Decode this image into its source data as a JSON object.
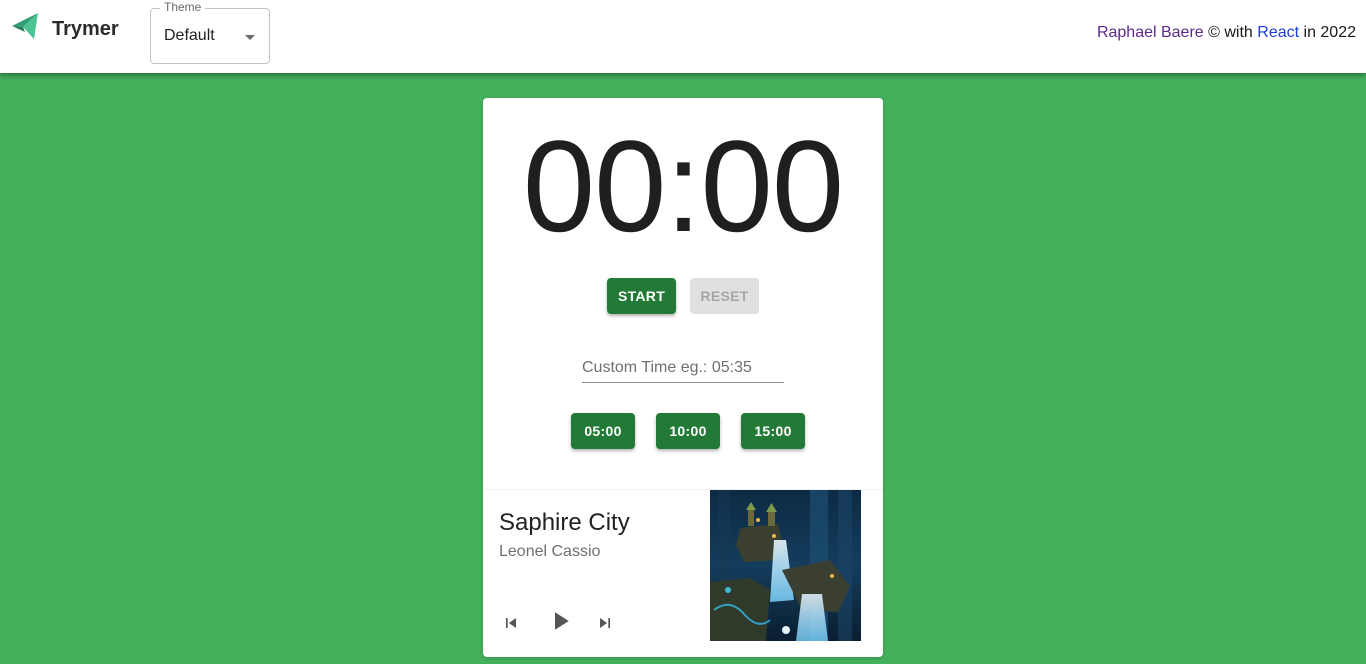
{
  "header": {
    "brand": "Trymer",
    "logo_icon": "paper-plane-icon",
    "theme_label": "Theme",
    "theme_value": "Default",
    "credits": {
      "author": "Raphael Baere",
      "middle": " © with ",
      "tech": "React",
      "suffix": " in 2022"
    }
  },
  "timer": {
    "display": "00:00",
    "start_label": "START",
    "reset_label": "RESET",
    "custom_placeholder": "Custom Time eg.: 05:35",
    "presets": [
      "05:00",
      "10:00",
      "15:00"
    ]
  },
  "player": {
    "title": "Saphire City",
    "artist": "Leonel Cassio",
    "prev_icon": "skip-previous-icon",
    "play_icon": "play-icon",
    "next_icon": "skip-next-icon"
  },
  "colors": {
    "background": "#43b05c",
    "button_green": "#237a37",
    "logo": "#3fb58a",
    "author_link": "#5b2a8a",
    "react_link": "#1a3fd6"
  }
}
